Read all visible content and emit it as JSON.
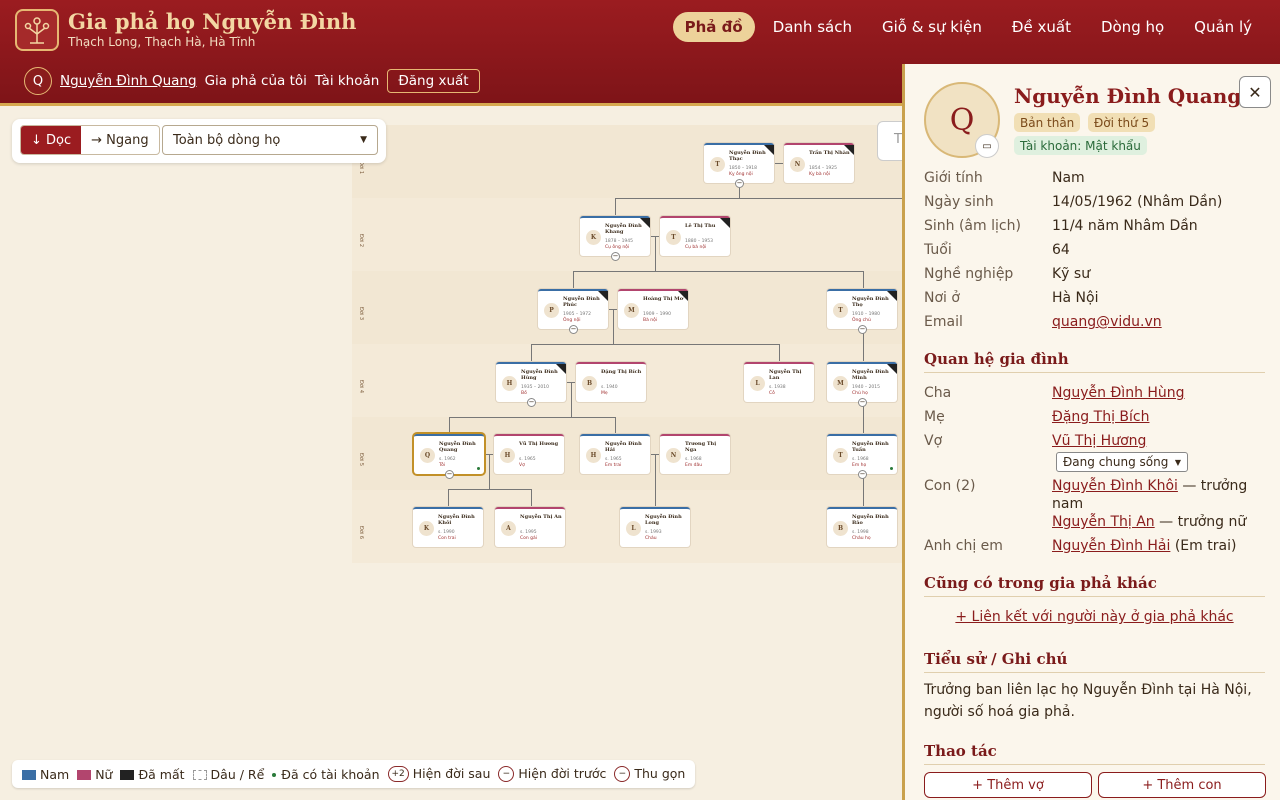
{
  "app": {
    "title": "Gia phả họ Nguyễn Đình",
    "subtitle": "Thạch Long, Thạch Hà, Hà Tĩnh"
  },
  "nav": [
    "Phả đồ",
    "Danh sách",
    "Giỗ & sự kiện",
    "Đề xuất",
    "Dòng họ",
    "Quản lý"
  ],
  "user": {
    "initial": "Q",
    "name": "Nguyễn Đình Quang",
    "my_tree": "Gia phả của tôi",
    "account": "Tài khoản",
    "logout": "Đăng xuất"
  },
  "toolbar": {
    "vertical": "↓ Dọc",
    "horizontal": "→ Ngang",
    "scope": "Toàn bộ dòng họ",
    "search_stub": "T"
  },
  "generations": [
    "Đời 1",
    "Đời 2",
    "Đời 3",
    "Đời 4",
    "Đời 5",
    "Đời 6"
  ],
  "nodes": [
    {
      "i": "T",
      "n": "Nguyễn Đình Thạc",
      "y": "1850 – 1918",
      "r": "Kỵ ông nội"
    },
    {
      "i": "N",
      "n": "Trần Thị Nhàn",
      "y": "1854 – 1925",
      "r": "Kỵ bà nội"
    },
    {
      "i": "K",
      "n": "Nguyễn Đình Khang",
      "y": "1878 – 1945",
      "r": "Cụ ông nội"
    },
    {
      "i": "T",
      "n": "Lê Thị Thu",
      "y": "1880 – 1953",
      "r": "Cụ bà nội"
    },
    {
      "i": "P",
      "n": "Nguyễn Đình Phúc",
      "y": "1905 – 1972",
      "r": "Ông nội"
    },
    {
      "i": "M",
      "n": "Hoàng Thị Mơ",
      "y": "1909 – 1990",
      "r": "Bà nội"
    },
    {
      "i": "T",
      "n": "Nguyễn Đình Thọ",
      "y": "1910 – 1980",
      "r": "Ông chú"
    },
    {
      "i": "H",
      "n": "Nguyễn Đình Hùng",
      "y": "1935 – 2010",
      "r": "Bố"
    },
    {
      "i": "B",
      "n": "Đặng Thị Bích",
      "y": "s. 1940",
      "r": "Mẹ"
    },
    {
      "i": "L",
      "n": "Nguyễn Thị Lan",
      "y": "s. 1938",
      "r": "Cô"
    },
    {
      "i": "M",
      "n": "Nguyễn Đình Minh",
      "y": "1940 – 2015",
      "r": "Chú họ"
    },
    {
      "i": "Q",
      "n": "Nguyễn Đình Quang",
      "y": "s. 1962",
      "r": "Tôi"
    },
    {
      "i": "H",
      "n": "Vũ Thị Hương",
      "y": "s. 1965",
      "r": "Vợ"
    },
    {
      "i": "H",
      "n": "Nguyễn Đình Hải",
      "y": "s. 1965",
      "r": "Em trai"
    },
    {
      "i": "N",
      "n": "Trương Thị Nga",
      "y": "s. 1968",
      "r": "Em dâu"
    },
    {
      "i": "T",
      "n": "Nguyễn Đình Tuấn",
      "y": "s. 1968",
      "r": "Em họ"
    },
    {
      "i": "K",
      "n": "Nguyễn Đình Khôi",
      "y": "s. 1990",
      "r": "Con trai"
    },
    {
      "i": "A",
      "n": "Nguyễn Thị An",
      "y": "s. 1995",
      "r": "Con gái"
    },
    {
      "i": "L",
      "n": "Nguyễn Đình Long",
      "y": "s. 1993",
      "r": "Cháu"
    },
    {
      "i": "B",
      "n": "Nguyễn Đình Bảo",
      "y": "s. 1998",
      "r": "Cháu họ"
    }
  ],
  "legend": {
    "male": "Nam",
    "female": "Nữ",
    "deceased": "Đã mất",
    "inlaw": "Dâu / Rể",
    "account": "Đã có tài khoản",
    "show_later_count": "+2",
    "show_later": "Hiện đời sau",
    "show_earlier": "Hiện đời trước",
    "collapse": "Thu gọn"
  },
  "panel": {
    "initial": "Q",
    "name": "Nguyễn Đình Quang",
    "badge_self": "Bản thân",
    "badge_gen": "Đời thứ 5",
    "badge_account": "Tài khoản: Mật khẩu",
    "info": [
      [
        "Giới tính",
        "Nam"
      ],
      [
        "Ngày sinh",
        "14/05/1962 (Nhâm Dần)"
      ],
      [
        "Sinh (âm lịch)",
        "11/4 năm Nhâm Dần"
      ],
      [
        "Tuổi",
        "64"
      ],
      [
        "Nghề nghiệp",
        "Kỹ sư"
      ],
      [
        "Nơi ở",
        "Hà Nội"
      ]
    ],
    "email_label": "Email",
    "email": "quang@vidu.vn",
    "family_title": "Quan hệ gia đình",
    "father_label": "Cha",
    "father": "Nguyễn Đình Hùng",
    "mother_label": "Mẹ",
    "mother": "Đặng Thị Bích",
    "wife_label": "Vợ",
    "wife": "Vũ Thị Hương",
    "marital": "Đang chung sống",
    "children_label": "Con (2)",
    "child1": "Nguyễn Đình Khôi",
    "child1_role": "— trưởng",
    "child1_role2": "nam",
    "child2": "Nguyễn Thị An",
    "child2_role": "— trưởng nữ",
    "siblings_label": "Anh chị em",
    "sibling": "Nguyễn Đình Hải",
    "sibling_role": "(Em trai)",
    "other_title": "Cũng có trong gia phả khác",
    "link_other": "+ Liên kết với người này ở gia phả khác",
    "bio_title": "Tiểu sử / Ghi chú",
    "bio1": "Trưởng ban liên lạc họ Nguyễn Đình tại Hà Nội,",
    "bio2": "người số hoá gia phả.",
    "actions_title": "Thao tác",
    "add_wife": "+ Thêm vợ",
    "add_child": "+ Thêm con"
  },
  "colors": {
    "brand": "#9b1c20",
    "gold": "#d6a84f",
    "male": "#3a6ea5",
    "female": "#b2456e"
  }
}
